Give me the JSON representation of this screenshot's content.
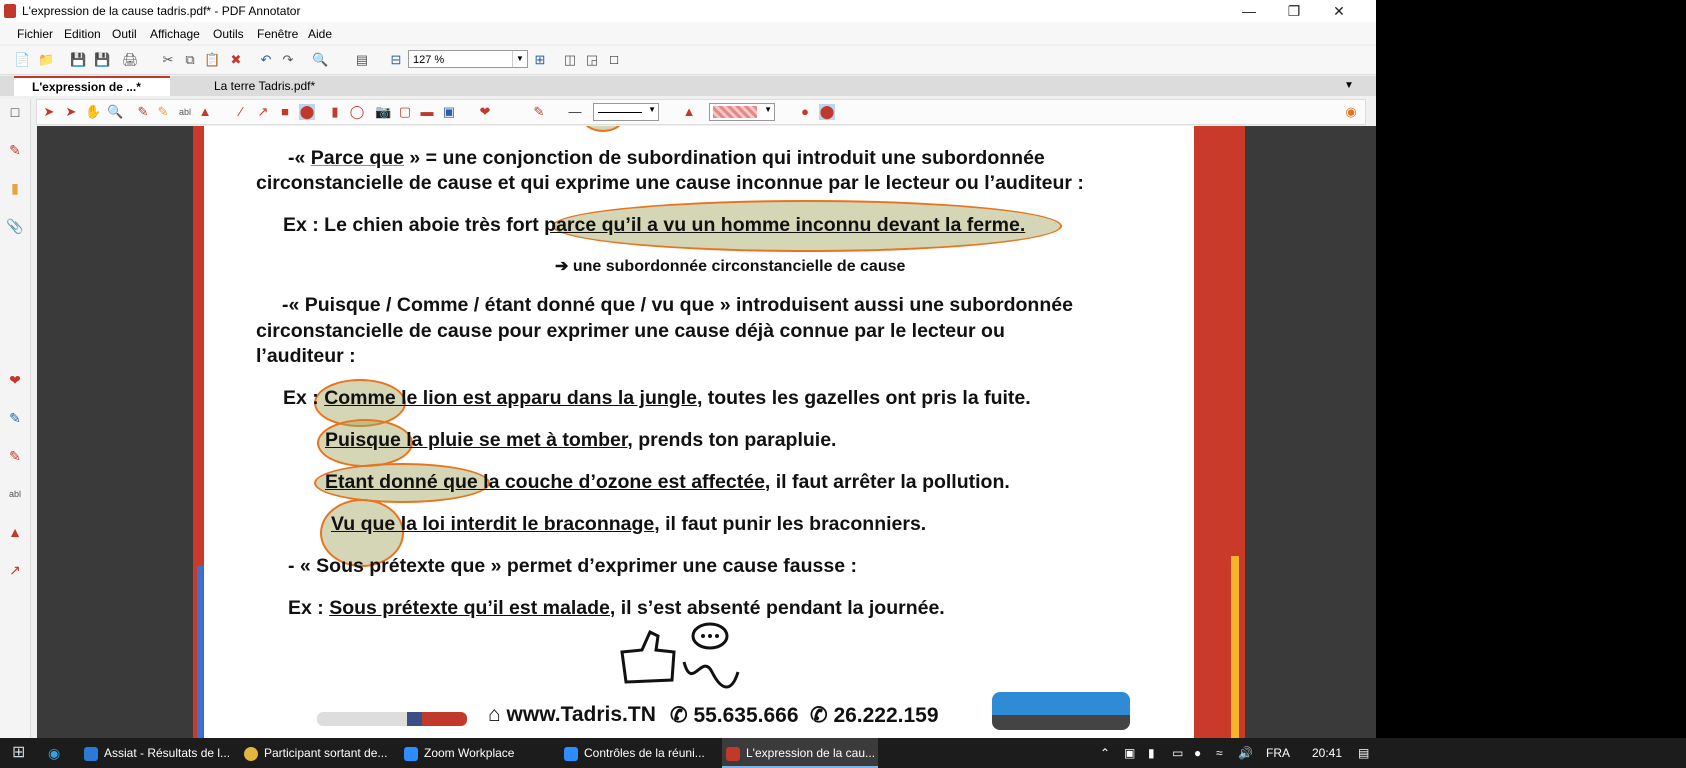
{
  "window": {
    "title": "L'expression de la cause tadris.pdf* - PDF Annotator"
  },
  "menu": [
    "Fichier",
    "Edition",
    "Outil",
    "Affichage",
    "Outils",
    "Fenêtre",
    "Aide"
  ],
  "toolbar": {
    "zoom": "127 %"
  },
  "tabs": [
    {
      "label": "L'expression de ...*"
    },
    {
      "label": "La terre Tadris.pdf*"
    }
  ],
  "document": {
    "p1_line1_a": "-« ",
    "p1_line1_term": "Parce que",
    "p1_line1_b": " » = une conjonction de subordination qui introduit une subordonnée",
    "p1_line2": "circonstancielle de cause et qui exprime une cause inconnue par le lecteur ou l’auditeur :",
    "ex1_a": "Ex : Le chien aboie très fort ",
    "ex1_u": "parce qu’il a vu un homme inconnu devant la ferme.",
    "arrow_note": "➔ une subordonnée circonstancielle de cause",
    "p2_line1": "-« Puisque / Comme / étant donné que / vu que » introduisent aussi une subordonnée",
    "p2_line2": "circonstancielle de cause pour exprimer une cause déjà connue par le lecteur ou",
    "p2_line3": "l’auditeur :",
    "ex2_prefix": "Ex : ",
    "ex2_u": "Comme le lion est apparu dans la jungle",
    "ex2_rest": ", toutes les gazelles ont pris la fuite.",
    "ex3_u": "Puisque la pluie se met à tomber",
    "ex3_rest": ", prends ton parapluie.",
    "ex4_u": "Etant donné que la couche d’ozone est affectée",
    "ex4_rest": ", il faut arrêter la pollution.",
    "ex5_u": "Vu que la loi interdit le braconnage",
    "ex5_rest": ", il faut punir les braconniers.",
    "p3": "-    « Sous prétexte que » permet d’exprimer une cause fausse :",
    "ex6_prefix": "Ex : ",
    "ex6_u": "Sous prétexte qu’il est malade",
    "ex6_rest": ", il s’est absenté pendant la journée.",
    "footer_site": "www.Tadris.TN",
    "footer_phone1": "55.635.666",
    "footer_phone2": "26.222.159"
  },
  "taskbar": {
    "items": [
      {
        "label": "Assiat - Résultats de l..."
      },
      {
        "label": "Participant sortant de..."
      },
      {
        "label": "Zoom Workplace"
      },
      {
        "label": "Contrôles de la réuni..."
      },
      {
        "label": "L'expression de la cau..."
      }
    ],
    "language": "FRA",
    "time": "20:41"
  }
}
